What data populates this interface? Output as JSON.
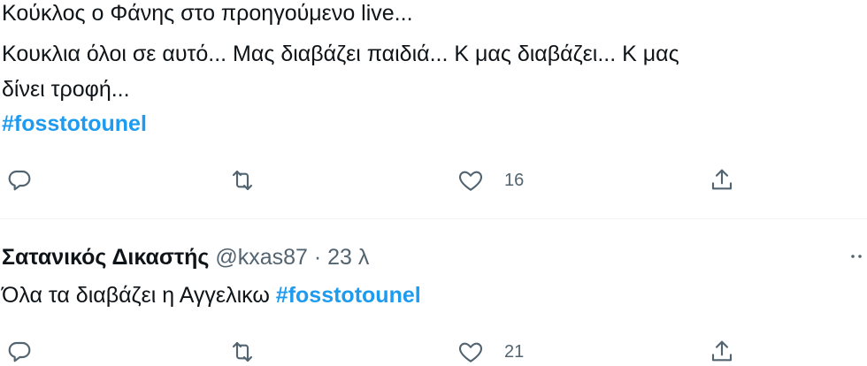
{
  "tweet1": {
    "lines": [
      "Κούκλος ο Φάνης στο προηγούμενο live...",
      "Κουκλια όλοι σε αυτό... Μας διαβάζει παιδιά... Κ μας διαβάζει... Κ μας",
      "δίνει τροφή..."
    ],
    "hashtag": "#fosstotounel",
    "actions": {
      "reply_icon": "reply-icon",
      "retweet_icon": "retweet-icon",
      "like_icon": "heart-icon",
      "like_count": "16",
      "share_icon": "share-icon"
    }
  },
  "tweet2": {
    "author_name": "Σατανικός Δικαστής",
    "author_handle": "@kxas87",
    "separator": "·",
    "timestamp": "23 λ",
    "text": "Όλα τα διαβάζει η Αγγελικω",
    "hashtag": "#fosstotounel",
    "actions": {
      "reply_icon": "reply-icon",
      "retweet_icon": "retweet-icon",
      "like_icon": "heart-icon",
      "like_count": "21",
      "share_icon": "share-icon"
    },
    "more_icon": "more-icon"
  },
  "colors": {
    "text": "#0f1419",
    "secondary": "#536471",
    "link": "#1d9bf0",
    "divider": "#eff3f4"
  }
}
